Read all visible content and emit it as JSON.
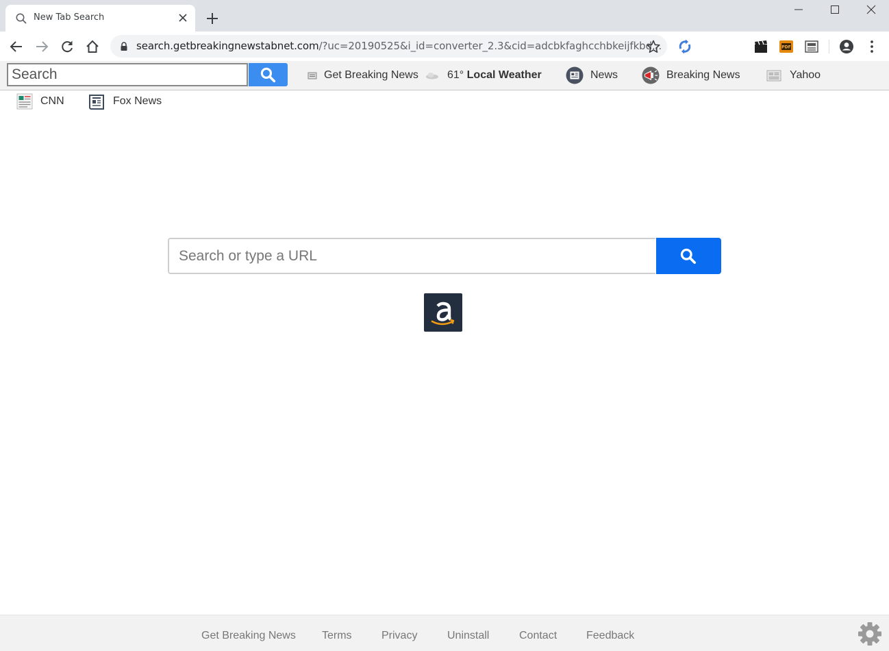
{
  "browser": {
    "tab_title": "New Tab Search",
    "url_host": "search.getbreakingnewstabnet.com",
    "url_rest": "/?uc=20190525&i_id=converter_2.3&cid=adcbkfaghcchbkeijfkbd..."
  },
  "toolbar": {
    "search_placeholder": "Search",
    "links": [
      {
        "label": "Get Breaking News",
        "icon": "newspaper-icon"
      },
      {
        "label": "61°",
        "label_bold": "Local Weather",
        "icon": "cloud-icon"
      },
      {
        "label": "News",
        "icon": "news-icon"
      },
      {
        "label": "Breaking News",
        "icon": "megaphone-icon"
      },
      {
        "label": "Yahoo",
        "icon": "newspaper-icon"
      }
    ],
    "row2_links": [
      {
        "label": "CNN",
        "icon": "news-page-icon"
      },
      {
        "label": "Fox News",
        "icon": "newspaper-icon"
      }
    ]
  },
  "main": {
    "search_placeholder": "Search or type a URL",
    "shortcut": "amazon-icon"
  },
  "footer": {
    "links": [
      "Get Breaking News",
      "Terms",
      "Privacy",
      "Uninstall",
      "Contact",
      "Feedback"
    ]
  },
  "colors": {
    "primary_blue": "#0a6cf0",
    "toolbar_blue": "#3b8ef0"
  }
}
